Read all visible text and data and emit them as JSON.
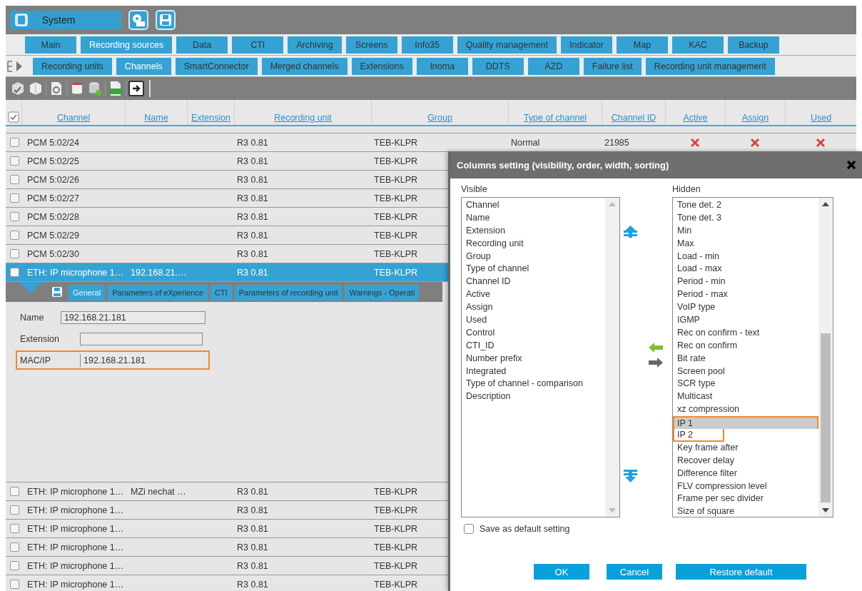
{
  "top_bar": {
    "module_button": "System"
  },
  "main_tabs": [
    {
      "label": "Main",
      "selected": false
    },
    {
      "label": "Recording sources",
      "selected": true
    },
    {
      "label": "Data",
      "selected": false
    },
    {
      "label": "CTI",
      "selected": false
    },
    {
      "label": "Archiving",
      "selected": false
    },
    {
      "label": "Screens",
      "selected": false
    },
    {
      "label": "Info35",
      "selected": false
    },
    {
      "label": "Quality management",
      "selected": false
    },
    {
      "label": "Indicator",
      "selected": false
    },
    {
      "label": "Map",
      "selected": false
    },
    {
      "label": "KAC",
      "selected": false
    },
    {
      "label": "Backup",
      "selected": false
    }
  ],
  "sub_tabs": [
    {
      "label": "Recording units",
      "selected": false
    },
    {
      "label": "Channels",
      "selected": true
    },
    {
      "label": "SmartConnector",
      "selected": false
    },
    {
      "label": "Merged channels",
      "selected": false
    },
    {
      "label": "Extensions",
      "selected": false
    },
    {
      "label": "Inoma",
      "selected": false
    },
    {
      "label": "DDTS",
      "selected": false
    },
    {
      "label": "AZD",
      "selected": false
    },
    {
      "label": "Failure list",
      "selected": false
    },
    {
      "label": "Recording unit management",
      "selected": false
    }
  ],
  "table": {
    "columns": [
      "Channel",
      "Name",
      "Extension",
      "Recording unit",
      "Group",
      "Type of channel",
      "Channel ID",
      "Active",
      "Assign",
      "Used"
    ],
    "rows": [
      {
        "checked": false,
        "selected": false,
        "channel": "PCM 5:02/24",
        "recording_unit": "R3 0.81",
        "group": "TEB-KLPR",
        "type_of_channel": "Normal",
        "channel_id": "21985",
        "active": false,
        "assign": false,
        "used": false
      },
      {
        "checked": false,
        "selected": false,
        "channel": "PCM 5:02/25",
        "recording_unit": "R3 0.81",
        "group": "TEB-KLPR"
      },
      {
        "checked": false,
        "selected": false,
        "channel": "PCM 5:02/26",
        "recording_unit": "R3 0.81",
        "group": "TEB-KLPR"
      },
      {
        "checked": false,
        "selected": false,
        "channel": "PCM 5:02/27",
        "recording_unit": "R3 0.81",
        "group": "TEB-KLPR"
      },
      {
        "checked": false,
        "selected": false,
        "channel": "PCM 5:02/28",
        "recording_unit": "R3 0.81",
        "group": "TEB-KLPR"
      },
      {
        "checked": false,
        "selected": false,
        "channel": "PCM 5:02/29",
        "recording_unit": "R3 0.81",
        "group": "TEB-KLPR"
      },
      {
        "checked": false,
        "selected": false,
        "channel": "PCM 5:02/30",
        "recording_unit": "R3 0.81",
        "group": "TEB-KLPR"
      },
      {
        "checked": false,
        "selected": true,
        "channel": "ETH: IP microphone 1…",
        "name": "192.168.21.…",
        "recording_unit": "R3 0.81",
        "group": "TEB-KLPR"
      },
      {
        "checked": false,
        "selected": false,
        "channel": "ETH: IP microphone 1…",
        "name": "MZi nechat …",
        "recording_unit": "R3 0.81",
        "group": "TEB-KLPR"
      },
      {
        "checked": false,
        "selected": false,
        "channel": "ETH: IP microphone 1…",
        "recording_unit": "R3 0.81",
        "group": "TEB-KLPR"
      },
      {
        "checked": false,
        "selected": false,
        "channel": "ETH: IP microphone 1…",
        "recording_unit": "R3 0.81",
        "group": "TEB-KLPR"
      },
      {
        "checked": false,
        "selected": false,
        "channel": "ETH: IP microphone 1…",
        "recording_unit": "R3 0.81",
        "group": "TEB-KLPR"
      },
      {
        "checked": false,
        "selected": false,
        "channel": "ETH: IP microphone 1…",
        "recording_unit": "R3 0.81",
        "group": "TEB-KLPR"
      },
      {
        "checked": false,
        "selected": false,
        "channel": "ETH: IP microphone 1…",
        "recording_unit": "R3 0.81",
        "group": "TEB-KLPR"
      }
    ]
  },
  "detail": {
    "tabs": [
      {
        "label": "General",
        "selected": true
      },
      {
        "label": "Parameters of eXperience",
        "selected": false
      },
      {
        "label": "CTI",
        "selected": false
      },
      {
        "label": "Parameters of recording unit",
        "selected": false
      },
      {
        "label": "Warnings - Operati",
        "selected": false
      }
    ],
    "fields": [
      {
        "label": "Name",
        "value": "192.168.21.181",
        "highlighted": false
      },
      {
        "label": "Extension",
        "highlighted": false
      },
      {
        "label": "MAC/IP",
        "value": "192.168.21.181",
        "highlighted": true
      }
    ]
  },
  "dialog": {
    "title": "Columns setting (visibility, order, width, sorting)",
    "visible_label": "Visible",
    "hidden_label": "Hidden",
    "visible_items": [
      {
        "label": "Channel",
        "selected": false
      },
      {
        "label": "Name",
        "selected": false
      },
      {
        "label": "Extension",
        "selected": false
      },
      {
        "label": "Recording unit",
        "selected": false
      },
      {
        "label": "Group",
        "selected": false
      },
      {
        "label": "Type of channel",
        "selected": false
      },
      {
        "label": "Channel ID",
        "selected": false
      },
      {
        "label": "Active",
        "selected": false
      },
      {
        "label": "Assign",
        "selected": false
      },
      {
        "label": "Used",
        "selected": false
      },
      {
        "label": "Control",
        "selected": false
      },
      {
        "label": "CTI_ID",
        "selected": false
      },
      {
        "label": "Number prefix",
        "selected": false
      },
      {
        "label": "Integrated",
        "selected": false
      },
      {
        "label": "Type of channel - comparison",
        "selected": false
      },
      {
        "label": "Description",
        "selected": false
      }
    ],
    "hidden_items": [
      {
        "label": "Tone det. 2",
        "selected": false,
        "highlighted": false
      },
      {
        "label": "Tone det. 3",
        "selected": false,
        "highlighted": false
      },
      {
        "label": "Min",
        "selected": false,
        "highlighted": false
      },
      {
        "label": "Max",
        "selected": false,
        "highlighted": false
      },
      {
        "label": "Load - min",
        "selected": false,
        "highlighted": false
      },
      {
        "label": "Load - max",
        "selected": false,
        "highlighted": false
      },
      {
        "label": "Period - min",
        "selected": false,
        "highlighted": false
      },
      {
        "label": "Period - max",
        "selected": false,
        "highlighted": false
      },
      {
        "label": "VoIP type",
        "selected": false,
        "highlighted": false
      },
      {
        "label": "IGMP",
        "selected": false,
        "highlighted": false
      },
      {
        "label": "Rec on confirm - text",
        "selected": false,
        "highlighted": false
      },
      {
        "label": "Rec on confirm",
        "selected": false,
        "highlighted": false
      },
      {
        "label": "Bit rate",
        "selected": false,
        "highlighted": false
      },
      {
        "label": "Screen pool",
        "selected": false,
        "highlighted": false
      },
      {
        "label": "SCR type",
        "selected": false,
        "highlighted": false
      },
      {
        "label": "Multicast",
        "selected": false,
        "highlighted": false
      },
      {
        "label": "xz compression",
        "selected": false,
        "highlighted": false
      },
      {
        "label": "IP 1",
        "selected": true,
        "highlighted": true
      },
      {
        "label": "IP 2",
        "selected": false,
        "highlighted": true
      },
      {
        "label": "Key frame after",
        "selected": false,
        "highlighted": false
      },
      {
        "label": "Recover delay",
        "selected": false,
        "highlighted": false
      },
      {
        "label": "Difference filter",
        "selected": false,
        "highlighted": false
      },
      {
        "label": "FLV compression level",
        "selected": false,
        "highlighted": false
      },
      {
        "label": "Frame per sec divider",
        "selected": false,
        "highlighted": false
      },
      {
        "label": "Size of square",
        "selected": false,
        "highlighted": false
      }
    ],
    "save_default": {
      "label": "Save as default setting",
      "checked": false
    },
    "buttons": [
      "OK",
      "Cancel",
      "Restore default"
    ]
  }
}
